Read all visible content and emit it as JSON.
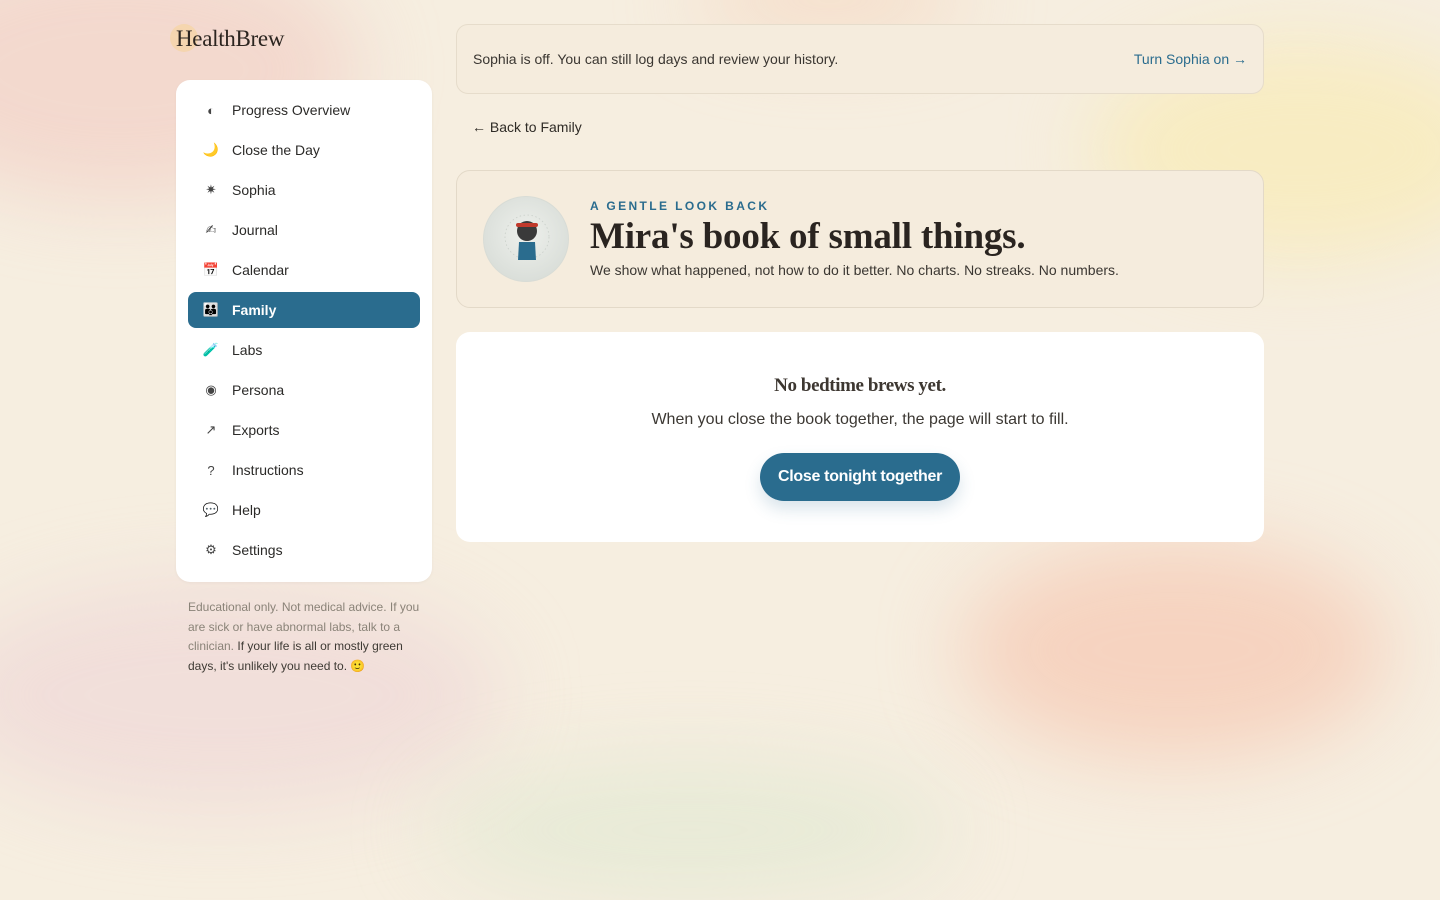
{
  "app": {
    "name": "HealthBrew"
  },
  "banner": {
    "text": "Sophia is off. You can still log days and review your history.",
    "link": "Turn Sophia on →"
  },
  "back_link": "← Back to Family",
  "sidebar": {
    "items": [
      {
        "label": "Progress Overview",
        "icon": "half-moon-icon",
        "glyph": "◐"
      },
      {
        "label": "Close the Day",
        "icon": "crescent-moon-icon",
        "glyph": "🌙"
      },
      {
        "label": "Sophia",
        "icon": "sparkle-icon",
        "glyph": "✷"
      },
      {
        "label": "Journal",
        "icon": "writing-hand-icon",
        "glyph": "✍"
      },
      {
        "label": "Calendar",
        "icon": "calendar-icon",
        "glyph": "📅"
      },
      {
        "label": "Family",
        "icon": "family-icon",
        "glyph": "👪",
        "active": true
      },
      {
        "label": "Labs",
        "icon": "test-tube-icon",
        "glyph": "🧪"
      },
      {
        "label": "Persona",
        "icon": "radio-dot-icon",
        "glyph": "◉"
      },
      {
        "label": "Exports",
        "icon": "arrow-up-right-icon",
        "glyph": "↗"
      },
      {
        "label": "Instructions",
        "icon": "question-icon",
        "glyph": "?"
      },
      {
        "label": "Help",
        "icon": "speech-bubble-icon",
        "glyph": "💬"
      },
      {
        "label": "Settings",
        "icon": "gear-icon",
        "glyph": "⚙"
      }
    ]
  },
  "disclaimer": {
    "muted": "Educational only. Not medical advice. If you are sick or have abnormal labs, talk to a clinician.",
    "dark": "If your life is all or mostly green days, it's unlikely you need to. 🙂"
  },
  "hero": {
    "eyebrow": "A GENTLE LOOK BACK",
    "title": "Mira's book of small things.",
    "subtitle": "We show what happened, not how to do it better. No charts. No streaks. No numbers."
  },
  "empty_state": {
    "title": "No bedtime brews yet.",
    "text": "When you close the book together, the page will start to fill.",
    "button": "Close tonight together"
  },
  "colors": {
    "accent": "#2a6c8e",
    "background": "#f6eee0",
    "card": "#ffffff",
    "banner": "#f5ecdd"
  }
}
